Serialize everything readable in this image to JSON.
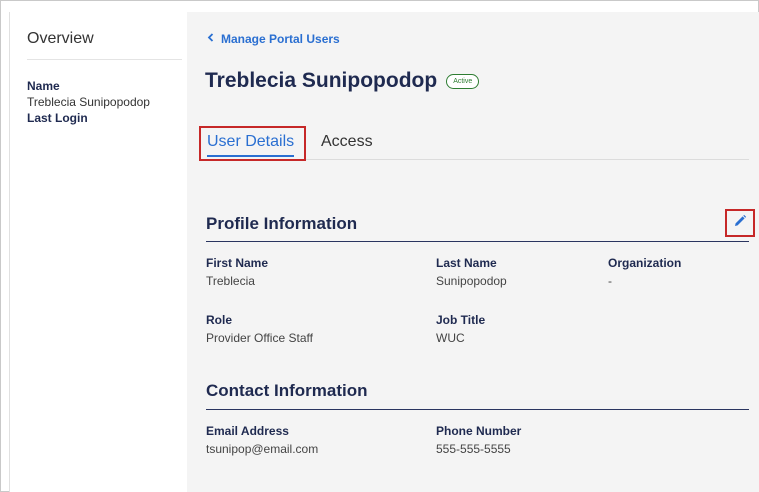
{
  "sidebar": {
    "title": "Overview",
    "name_label": "Name",
    "name_value": "Treblecia Sunipopodop",
    "last_login_label": "Last Login"
  },
  "main": {
    "back_link": "Manage Portal Users",
    "user_name": "Treblecia Sunipopodop",
    "status": "Active",
    "tabs": [
      {
        "label": "User Details",
        "active": true
      },
      {
        "label": "Access",
        "active": false
      }
    ],
    "profile": {
      "title": "Profile Information",
      "first_name_label": "First Name",
      "first_name": "Treblecia",
      "last_name_label": "Last Name",
      "last_name": "Sunipopodop",
      "organization_label": "Organization",
      "organization": "-",
      "role_label": "Role",
      "role": "Provider Office Staff",
      "job_title_label": "Job Title",
      "job_title": "WUC"
    },
    "contact": {
      "title": "Contact Information",
      "email_label": "Email Address",
      "email": "tsunipop@email.com",
      "phone_label": "Phone Number",
      "phone": "555-555-5555"
    }
  },
  "colors": {
    "accent": "#2a6fd1",
    "heading": "#1f2a50",
    "highlight": "#c62828",
    "status": "#2e7d32"
  },
  "icons": {
    "back": "chevron-left-icon",
    "edit": "pencil-icon"
  }
}
